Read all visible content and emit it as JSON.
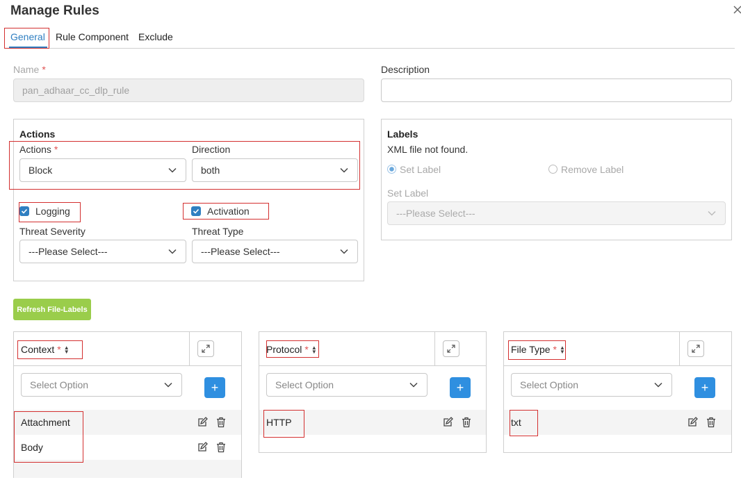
{
  "dialog": {
    "title": "Manage Rules"
  },
  "tabs": [
    {
      "label": "General",
      "active": true
    },
    {
      "label": "Rule Component",
      "active": false
    },
    {
      "label": "Exclude",
      "active": false
    }
  ],
  "name": {
    "label": "Name",
    "value": "pan_adhaar_cc_dlp_rule"
  },
  "description": {
    "label": "Description",
    "value": ""
  },
  "actions_panel": {
    "title": "Actions",
    "actions": {
      "label": "Actions",
      "value": "Block"
    },
    "direction": {
      "label": "Direction",
      "value": "both"
    },
    "logging": {
      "label": "Logging",
      "checked": true
    },
    "activation": {
      "label": "Activation",
      "checked": true
    },
    "threat_severity": {
      "label": "Threat Severity",
      "value": "---Please Select---"
    },
    "threat_type": {
      "label": "Threat Type",
      "value": "---Please Select---"
    }
  },
  "labels_panel": {
    "title": "Labels",
    "message": "XML file not found.",
    "radio_set": "Set Label",
    "radio_remove": "Remove Label",
    "set_label": {
      "label": "Set Label",
      "value": "---Please Select---"
    }
  },
  "refresh_button": "Refresh File-Labels",
  "tables": {
    "context": {
      "header": "Context",
      "select_placeholder": "Select Option",
      "rows": [
        "Attachment",
        "Body"
      ]
    },
    "protocol": {
      "header": "Protocol",
      "select_placeholder": "Select Option",
      "rows": [
        "HTTP"
      ]
    },
    "file_type": {
      "header": "File Type",
      "select_placeholder": "Select Option",
      "rows": [
        "txt"
      ]
    }
  },
  "icons": {
    "close": "close-icon",
    "chevron": "chevron-down-icon",
    "expand": "expand-icon",
    "plus": "plus-icon",
    "edit": "edit-icon",
    "delete": "trash-icon",
    "sort": "sort-icon"
  },
  "colors": {
    "accent": "#2f7fc1",
    "highlight": "#d32f2f",
    "refresh_button": "#9acd4b",
    "plus_button": "#2f8fe0",
    "required": "#e05252"
  }
}
